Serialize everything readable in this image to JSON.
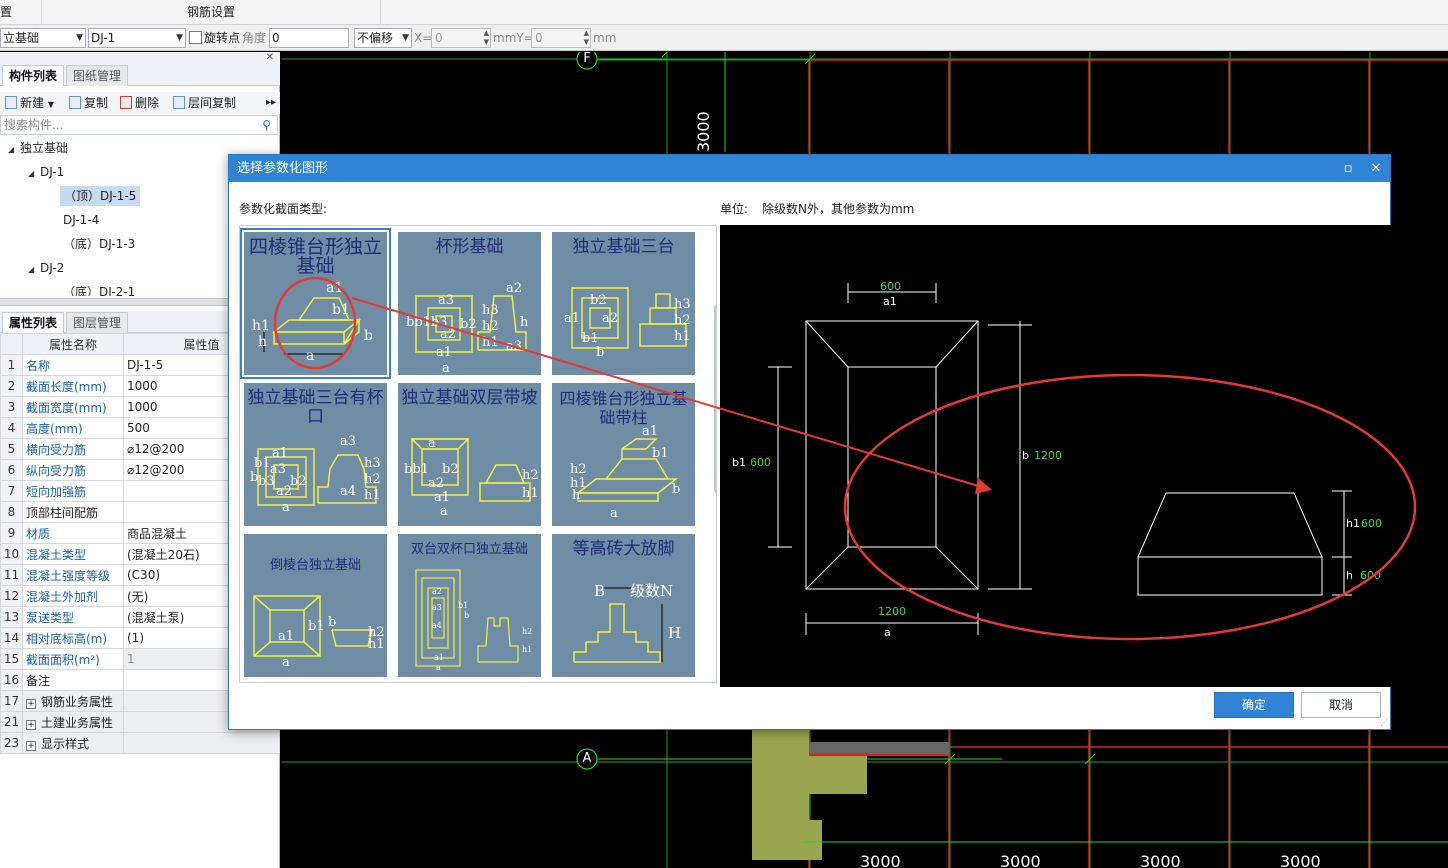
{
  "topbar": {
    "left_fragment": "置",
    "steel_settings": "钢筋设置"
  },
  "toolbar": {
    "category": "立基础",
    "component": "DJ-1",
    "rotate_point": "旋转点",
    "angle_label": "角度",
    "angle_value": "0",
    "offset": "不偏移",
    "x_label": "X=",
    "x_value": "0",
    "mm_y_label": "mmY=",
    "y_value": "0",
    "mm_label": "mm"
  },
  "component_panel": {
    "tabs": [
      "构件列表",
      "图纸管理"
    ],
    "buttons": {
      "new": "新建",
      "copy": "复制",
      "delete": "删除",
      "floor_copy": "层间复制"
    },
    "search_placeholder": "搜索构件...",
    "tree": [
      {
        "label": "独立基础"
      },
      {
        "label": "DJ-1"
      },
      {
        "label": "（顶）DJ-1-5"
      },
      {
        "label": "DJ-1-4"
      },
      {
        "label": "（底）DJ-1-3"
      },
      {
        "label": "DJ-2"
      },
      {
        "label": "（底）DJ-2-1"
      }
    ]
  },
  "property_panel": {
    "tabs": [
      "属性列表",
      "图层管理"
    ],
    "headers": {
      "name": "属性名称",
      "value": "属性值"
    },
    "rows": [
      {
        "idx": "1",
        "name": "名称",
        "value": "DJ-1-5"
      },
      {
        "idx": "2",
        "name": "截面长度(mm)",
        "value": "1000"
      },
      {
        "idx": "3",
        "name": "截面宽度(mm)",
        "value": "1000"
      },
      {
        "idx": "4",
        "name": "高度(mm)",
        "value": "500"
      },
      {
        "idx": "5",
        "name": "横向受力筋",
        "value": "⌀12@200"
      },
      {
        "idx": "6",
        "name": "纵向受力筋",
        "value": "⌀12@200"
      },
      {
        "idx": "7",
        "name": "短向加强筋",
        "value": ""
      },
      {
        "idx": "8",
        "name": "顶部柱间配筋",
        "value": ""
      },
      {
        "idx": "9",
        "name": "材质",
        "value": "商品混凝土"
      },
      {
        "idx": "10",
        "name": "混凝土类型",
        "value": "(混凝土20石)"
      },
      {
        "idx": "11",
        "name": "混凝土强度等级",
        "value": "(C30)"
      },
      {
        "idx": "12",
        "name": "混凝土外加剂",
        "value": "(无)"
      },
      {
        "idx": "13",
        "name": "泵送类型",
        "value": "(混凝土泵)"
      },
      {
        "idx": "14",
        "name": "相对底标高(m)",
        "value": "(1)"
      },
      {
        "idx": "15",
        "name": "截面面积(m²)",
        "value": "1"
      },
      {
        "idx": "16",
        "name": "备注",
        "value": ""
      },
      {
        "idx": "17",
        "name": "钢筋业务属性",
        "value": ""
      },
      {
        "idx": "21",
        "name": "土建业务属性",
        "value": ""
      },
      {
        "idx": "23",
        "name": "显示样式",
        "value": ""
      }
    ]
  },
  "canvas": {
    "axis_f": "F",
    "axis_a": "A",
    "dim_vertical": "3000",
    "dim_bottom": [
      "3000",
      "3000",
      "3000",
      "3000"
    ]
  },
  "dialog": {
    "title": "选择参数化图形",
    "section_label": "参数化截面类型:",
    "unit_label": "单位:",
    "unit_text": "除级数N外，其他参数为mm",
    "ok": "确定",
    "cancel": "取消",
    "thumbnails": [
      {
        "title": "四棱锥台形独立基础"
      },
      {
        "title": "杯形基础"
      },
      {
        "title": "独立基础三台"
      },
      {
        "title": "独立基础三台有杯口"
      },
      {
        "title": "独立基础双层带坡"
      },
      {
        "title": "四棱锥台形独立基础带柱"
      },
      {
        "title": "倒棱台独立基础"
      },
      {
        "title": "双台双杯口独立基础"
      },
      {
        "title": "等高砖大放脚"
      }
    ],
    "preview": {
      "a1_value": "600",
      "a1_label": "a1",
      "b1_label": "b1",
      "b1_value": "600",
      "b_label": "b",
      "b_value": "1200",
      "a_value": "1200",
      "a_label": "a",
      "h1_label": "h1",
      "h1_value": "600",
      "h_label": "h",
      "h_value": "600"
    }
  },
  "colors": {
    "accent": "#2f84d6",
    "annotation_red": "#e53935",
    "thumb_bg": "#6f8da4",
    "dim_green": "#33dd33"
  }
}
